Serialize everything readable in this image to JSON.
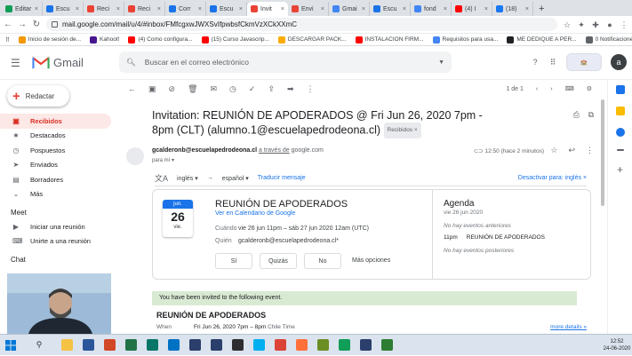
{
  "browser": {
    "tabs": [
      {
        "title": "Editar",
        "color": "#0f9d58"
      },
      {
        "title": "Escu",
        "color": "#1a73e8"
      },
      {
        "title": "Reci",
        "color": "#ea4335"
      },
      {
        "title": "Reci",
        "color": "#ea4335"
      },
      {
        "title": "Corr",
        "color": "#1a73e8"
      },
      {
        "title": "Escu",
        "color": "#1a73e8"
      },
      {
        "title": "Invit",
        "color": "#ea4335",
        "active": true
      },
      {
        "title": "Envi",
        "color": "#ea4335"
      },
      {
        "title": "Gmai",
        "color": "#4285f4"
      },
      {
        "title": "Escu",
        "color": "#1a73e8"
      },
      {
        "title": "fond",
        "color": "#4285f4"
      },
      {
        "title": "(4) I",
        "color": "#ff0000"
      },
      {
        "title": "(18)",
        "color": "#1877f2"
      }
    ],
    "url": "mail.google.com/mail/u/4/#inbox/FMfcgxwJWXSvIfpwbsfCkmVzXCkXXmC",
    "bookmarks": [
      {
        "label": "Inicio de sesión de...",
        "color": "#f29900"
      },
      {
        "label": "Kahoot!",
        "color": "#46178f"
      },
      {
        "label": "(4) Como configura...",
        "color": "#ff0000"
      },
      {
        "label": "(15) Curso Javascrip...",
        "color": "#ff0000"
      },
      {
        "label": "DESCARGAR PACK...",
        "color": "#f9ab00"
      },
      {
        "label": "INSTALACION FIRM...",
        "color": "#ff0000"
      },
      {
        "label": "Requisitos para usa...",
        "color": "#4285f4"
      },
      {
        "label": "ME DEDIQUE A PER...",
        "color": "#202124"
      },
      {
        "label": "0 Notificaciones",
        "color": "#5f6368"
      }
    ]
  },
  "gmail": {
    "product": "Gmail",
    "search_placeholder": "Buscar en el correo electrónico",
    "avatar_letter": "a",
    "compose": "Redactar",
    "sidebar": [
      {
        "label": "Recibidos",
        "icon": "inbox-icon",
        "glyph": "▣",
        "selected": true
      },
      {
        "label": "Destacados",
        "icon": "star-icon",
        "glyph": "★"
      },
      {
        "label": "Pospuestos",
        "icon": "clock-icon",
        "glyph": "◷"
      },
      {
        "label": "Enviados",
        "icon": "send-icon",
        "glyph": "➤"
      },
      {
        "label": "Borradores",
        "icon": "draft-icon",
        "glyph": "▤"
      },
      {
        "label": "Más",
        "icon": "chevron-down-icon",
        "glyph": "⌄"
      }
    ],
    "meet": {
      "title": "Meet",
      "items": [
        {
          "label": "Iniciar una reunión",
          "icon": "video-icon",
          "glyph": "▶"
        },
        {
          "label": "Unirte a una reunión",
          "icon": "keyboard-icon",
          "glyph": "⌨"
        }
      ]
    },
    "chat_title": "Chat",
    "pager": "1 de 1"
  },
  "email": {
    "subject": "Invitation: REUNIÓN DE APODERADOS @ Fri Jun 26, 2020 7pm - 8pm (CLT) (alumno.1@escuelapedrodeona.cl)",
    "label": "Recibidos ×",
    "sender": "gcalderonb@escuelapedrodeona.cl",
    "via": "a través de",
    "via_domain": "google.com",
    "to": "para mí",
    "time": "12:50 (hace 2 minutos)",
    "translate": {
      "from": "inglés",
      "to": "español",
      "action": "Traducir mensaje",
      "disable": "Desactivar para: inglés ×"
    }
  },
  "invite": {
    "month": "jun.",
    "day": "26",
    "weekday": "vie.",
    "title": "REUNIÓN DE APODERADOS",
    "calendar_link": "Ver en Calendario de Google",
    "when_label": "Cuándo",
    "when": "vie 26 jun 11pm – sáb 27 jun 2020 12am (UTC)",
    "who_label": "Quién",
    "who": "gcalderonb@escuelapedrodeona.cl*",
    "rsvp": [
      "Sí",
      "Quizás",
      "No"
    ],
    "more_options": "Más opciones",
    "agenda": {
      "title": "Agenda",
      "date": "vie 26 jun 2020",
      "before": "No hay eventos anteriores",
      "event_time": "11pm",
      "event_name": "REUNIÓN DE APODERADOS",
      "after": "No hay eventos posteriores"
    }
  },
  "body": {
    "banner": "You have been invited to the following event.",
    "event_title": "REUNIÓN DE APODERADOS",
    "when_label": "When",
    "when": "Fri Jun 26, 2020 7pm – 8pm",
    "tz": "Chile Time",
    "more": "more details »"
  },
  "taskbar": {
    "apps": [
      {
        "name": "file-explorer",
        "color": "#f6c244"
      },
      {
        "name": "word",
        "color": "#2b579a"
      },
      {
        "name": "powerpoint",
        "color": "#d24726"
      },
      {
        "name": "excel",
        "color": "#217346"
      },
      {
        "name": "publisher",
        "color": "#077568"
      },
      {
        "name": "outlook",
        "color": "#0072c6"
      },
      {
        "name": "pseint",
        "color": "#2a3f6b"
      },
      {
        "name": "pseint-2",
        "color": "#2a3f6b"
      },
      {
        "name": "windows-store",
        "color": "#2d2d30"
      },
      {
        "name": "skype",
        "color": "#00aff0"
      },
      {
        "name": "chrome",
        "color": "#db4437"
      },
      {
        "name": "firefox",
        "color": "#ff7139"
      },
      {
        "name": "cmaptools",
        "color": "#6b8e23"
      },
      {
        "name": "chrome-2",
        "color": "#0f9d58"
      },
      {
        "name": "pseint-3",
        "color": "#2a3f6b"
      },
      {
        "name": "app-green",
        "color": "#2e7d32"
      }
    ],
    "time": "12:52",
    "date": "24-06-2020"
  }
}
